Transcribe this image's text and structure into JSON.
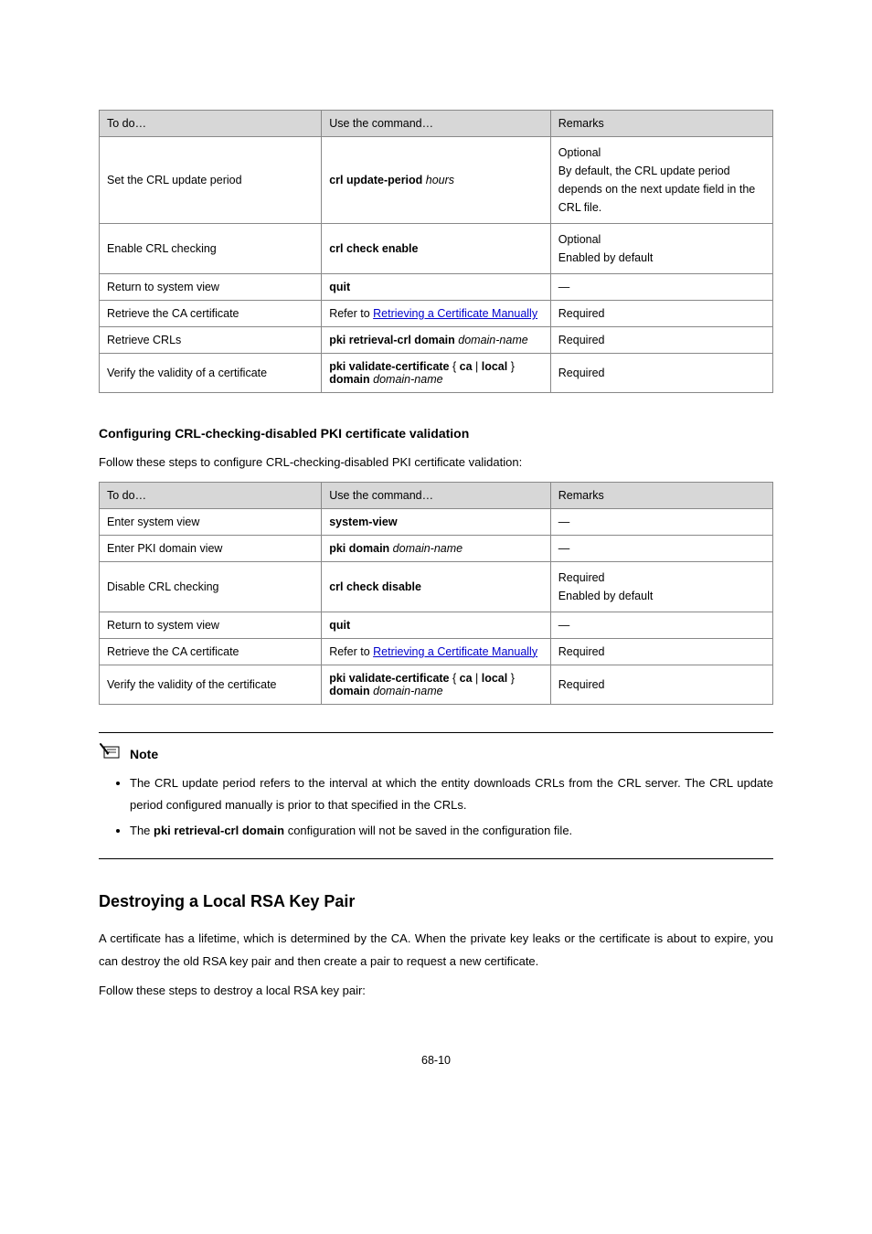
{
  "table1": {
    "headers": [
      "To do…",
      "Use the command…",
      "Remarks"
    ],
    "rows": [
      {
        "c1": "Set the CRL update period",
        "c2_plain": "crl update-period hours",
        "c3": "Optional\nBy default, the CRL update period depends on the next update field in the CRL file."
      },
      {
        "c1": "Enable CRL checking",
        "c2_plain": "crl check enable",
        "c3": "Optional\nEnabled by default"
      },
      {
        "c1": "Return to system view",
        "c2_plain": "quit",
        "c3": "—"
      },
      {
        "c1": "Retrieve the CA certificate",
        "c2_pre": "Refer to ",
        "c2_link": "Retrieving a Certificate Manually",
        "c3": "Required"
      },
      {
        "c1": "Retrieve CRLs",
        "c2_plain": "pki retrieval-crl domain domain-name",
        "c3": "Required"
      },
      {
        "c1": "Verify the validity of a certificate",
        "c2_plain": "pki validate-certificate { ca | local } domain domain-name",
        "c3": "Required"
      }
    ]
  },
  "section1_title": "Configuring CRL-checking-disabled PKI certificate validation",
  "section1_para": "Follow these steps to configure CRL-checking-disabled PKI certificate validation:",
  "table2": {
    "headers": [
      "To do…",
      "Use the command…",
      "Remarks"
    ],
    "rows": [
      {
        "c1": "Enter system view",
        "c2_plain": "system-view",
        "c3": "—"
      },
      {
        "c1": "Enter PKI domain view",
        "c2_plain": "pki domain domain-name",
        "c3": "—"
      },
      {
        "c1": "Disable CRL checking",
        "c2_plain": "crl check disable",
        "c3": "Required\nEnabled by default"
      },
      {
        "c1": "Return to system view",
        "c2_plain": "quit",
        "c3": "—"
      },
      {
        "c1": "Retrieve the CA certificate",
        "c2_pre": "Refer to ",
        "c2_link": "Retrieving a Certificate Manually",
        "c3": "Required"
      },
      {
        "c1": "Verify the validity of the certificate",
        "c2_plain": "pki validate-certificate { ca | local } domain domain-name",
        "c3": "Required"
      }
    ]
  },
  "note": {
    "label": "Note",
    "items": [
      "The CRL update period refers to the interval at which the entity downloads CRLs from the CRL server. The CRL update period configured manually is prior to that specified in the CRLs.",
      "The <b>pki retrieval-crl domain</b> configuration will not be saved in the configuration file."
    ]
  },
  "h2": "Destroying a Local RSA Key Pair",
  "para2": "A certificate has a lifetime, which is determined by the CA. When the private key leaks or the certificate is about to expire, you can destroy the old RSA key pair and then create a pair to request a new certificate.",
  "para3": "Follow these steps to destroy a local RSA key pair:",
  "pagenum": "68-10"
}
